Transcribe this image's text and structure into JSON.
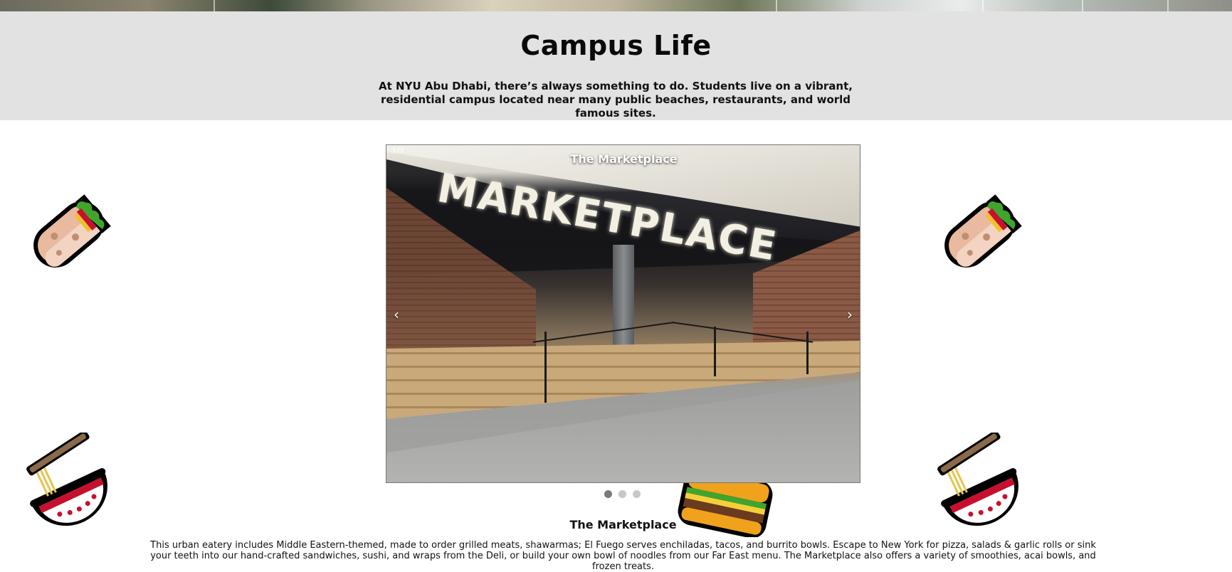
{
  "banner": {
    "title": "Campus Life",
    "intro": "At NYU Abu Dhabi, there’s always something to do. Students live on a vibrant, residential campus located near many public beaches, restaurants, and world famous sites."
  },
  "carousel": {
    "counter": "1/3",
    "caption": "The Marketplace",
    "photo_sign_text": "MARKETPLACE",
    "prev_label": "‹",
    "next_label": "›",
    "dots": [
      {
        "active": true
      },
      {
        "active": false
      },
      {
        "active": false
      }
    ]
  },
  "section": {
    "title": "The Marketplace",
    "description": "This urban eatery includes Middle Eastern-themed, made to order grilled meats, shawarmas; El Fuego serves enchiladas, tacos, and burrito bowls. Escape to New York for pizza, salads & garlic rolls or sink your teeth into our hand-crafted sandwiches, sushi, and wraps from the Deli, or build your own bowl of noodles from our Far East menu. The Marketplace also offers a variety of smoothies, acai bowls, and frozen treats."
  },
  "decorations": {
    "icons": [
      "burrito-icon",
      "burrito-icon",
      "noodle-bowl-icon",
      "noodle-bowl-icon",
      "burger-icon"
    ]
  },
  "colors": {
    "banner_bg": "#e2e2e2",
    "dot_active": "#7a7a7a",
    "dot_inactive": "#c8c8c8"
  }
}
